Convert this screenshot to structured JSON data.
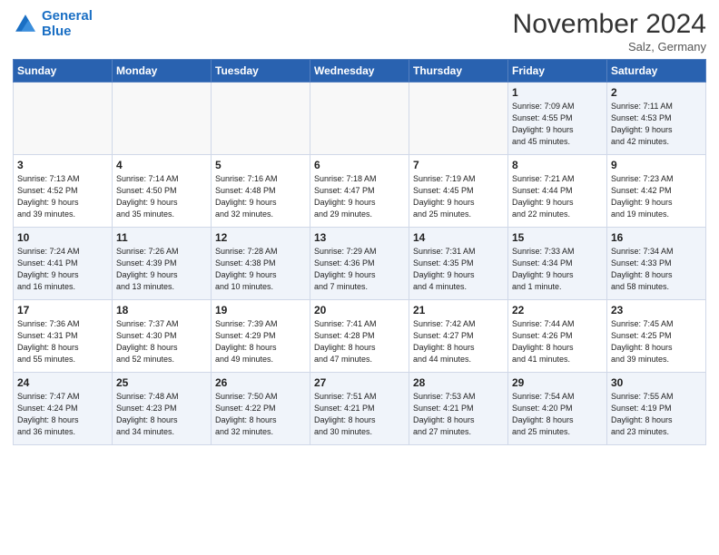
{
  "header": {
    "logo_line1": "General",
    "logo_line2": "Blue",
    "month_title": "November 2024",
    "location": "Salz, Germany"
  },
  "weekdays": [
    "Sunday",
    "Monday",
    "Tuesday",
    "Wednesday",
    "Thursday",
    "Friday",
    "Saturday"
  ],
  "weeks": [
    [
      {
        "day": "",
        "detail": ""
      },
      {
        "day": "",
        "detail": ""
      },
      {
        "day": "",
        "detail": ""
      },
      {
        "day": "",
        "detail": ""
      },
      {
        "day": "",
        "detail": ""
      },
      {
        "day": "1",
        "detail": "Sunrise: 7:09 AM\nSunset: 4:55 PM\nDaylight: 9 hours\nand 45 minutes."
      },
      {
        "day": "2",
        "detail": "Sunrise: 7:11 AM\nSunset: 4:53 PM\nDaylight: 9 hours\nand 42 minutes."
      }
    ],
    [
      {
        "day": "3",
        "detail": "Sunrise: 7:13 AM\nSunset: 4:52 PM\nDaylight: 9 hours\nand 39 minutes."
      },
      {
        "day": "4",
        "detail": "Sunrise: 7:14 AM\nSunset: 4:50 PM\nDaylight: 9 hours\nand 35 minutes."
      },
      {
        "day": "5",
        "detail": "Sunrise: 7:16 AM\nSunset: 4:48 PM\nDaylight: 9 hours\nand 32 minutes."
      },
      {
        "day": "6",
        "detail": "Sunrise: 7:18 AM\nSunset: 4:47 PM\nDaylight: 9 hours\nand 29 minutes."
      },
      {
        "day": "7",
        "detail": "Sunrise: 7:19 AM\nSunset: 4:45 PM\nDaylight: 9 hours\nand 25 minutes."
      },
      {
        "day": "8",
        "detail": "Sunrise: 7:21 AM\nSunset: 4:44 PM\nDaylight: 9 hours\nand 22 minutes."
      },
      {
        "day": "9",
        "detail": "Sunrise: 7:23 AM\nSunset: 4:42 PM\nDaylight: 9 hours\nand 19 minutes."
      }
    ],
    [
      {
        "day": "10",
        "detail": "Sunrise: 7:24 AM\nSunset: 4:41 PM\nDaylight: 9 hours\nand 16 minutes."
      },
      {
        "day": "11",
        "detail": "Sunrise: 7:26 AM\nSunset: 4:39 PM\nDaylight: 9 hours\nand 13 minutes."
      },
      {
        "day": "12",
        "detail": "Sunrise: 7:28 AM\nSunset: 4:38 PM\nDaylight: 9 hours\nand 10 minutes."
      },
      {
        "day": "13",
        "detail": "Sunrise: 7:29 AM\nSunset: 4:36 PM\nDaylight: 9 hours\nand 7 minutes."
      },
      {
        "day": "14",
        "detail": "Sunrise: 7:31 AM\nSunset: 4:35 PM\nDaylight: 9 hours\nand 4 minutes."
      },
      {
        "day": "15",
        "detail": "Sunrise: 7:33 AM\nSunset: 4:34 PM\nDaylight: 9 hours\nand 1 minute."
      },
      {
        "day": "16",
        "detail": "Sunrise: 7:34 AM\nSunset: 4:33 PM\nDaylight: 8 hours\nand 58 minutes."
      }
    ],
    [
      {
        "day": "17",
        "detail": "Sunrise: 7:36 AM\nSunset: 4:31 PM\nDaylight: 8 hours\nand 55 minutes."
      },
      {
        "day": "18",
        "detail": "Sunrise: 7:37 AM\nSunset: 4:30 PM\nDaylight: 8 hours\nand 52 minutes."
      },
      {
        "day": "19",
        "detail": "Sunrise: 7:39 AM\nSunset: 4:29 PM\nDaylight: 8 hours\nand 49 minutes."
      },
      {
        "day": "20",
        "detail": "Sunrise: 7:41 AM\nSunset: 4:28 PM\nDaylight: 8 hours\nand 47 minutes."
      },
      {
        "day": "21",
        "detail": "Sunrise: 7:42 AM\nSunset: 4:27 PM\nDaylight: 8 hours\nand 44 minutes."
      },
      {
        "day": "22",
        "detail": "Sunrise: 7:44 AM\nSunset: 4:26 PM\nDaylight: 8 hours\nand 41 minutes."
      },
      {
        "day": "23",
        "detail": "Sunrise: 7:45 AM\nSunset: 4:25 PM\nDaylight: 8 hours\nand 39 minutes."
      }
    ],
    [
      {
        "day": "24",
        "detail": "Sunrise: 7:47 AM\nSunset: 4:24 PM\nDaylight: 8 hours\nand 36 minutes."
      },
      {
        "day": "25",
        "detail": "Sunrise: 7:48 AM\nSunset: 4:23 PM\nDaylight: 8 hours\nand 34 minutes."
      },
      {
        "day": "26",
        "detail": "Sunrise: 7:50 AM\nSunset: 4:22 PM\nDaylight: 8 hours\nand 32 minutes."
      },
      {
        "day": "27",
        "detail": "Sunrise: 7:51 AM\nSunset: 4:21 PM\nDaylight: 8 hours\nand 30 minutes."
      },
      {
        "day": "28",
        "detail": "Sunrise: 7:53 AM\nSunset: 4:21 PM\nDaylight: 8 hours\nand 27 minutes."
      },
      {
        "day": "29",
        "detail": "Sunrise: 7:54 AM\nSunset: 4:20 PM\nDaylight: 8 hours\nand 25 minutes."
      },
      {
        "day": "30",
        "detail": "Sunrise: 7:55 AM\nSunset: 4:19 PM\nDaylight: 8 hours\nand 23 minutes."
      }
    ]
  ]
}
